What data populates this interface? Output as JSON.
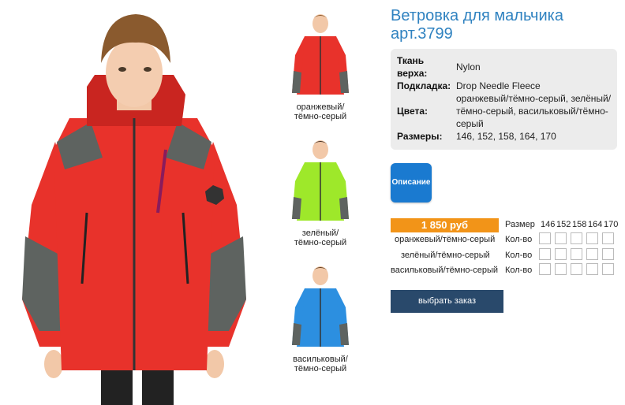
{
  "product": {
    "title": "Ветровка для мальчика арт.3799",
    "specs": [
      {
        "label": "Ткань верха:",
        "value": "Nylon"
      },
      {
        "label": "Подкладка:",
        "value": "Drop Needle Fleece"
      },
      {
        "label": "Цвета:",
        "value": "оранжевый/тёмно-серый, зелёный/тёмно-серый, васильковый/тёмно-серый"
      },
      {
        "label": "Размеры:",
        "value": "146, 152, 158, 164, 170"
      }
    ],
    "description_button": "Описание",
    "price": "1 850 руб",
    "order_button": "выбрать заказ"
  },
  "thumbnails": [
    {
      "caption_line1": "оранжевый/",
      "caption_line2": "тёмно-серый",
      "color": "#e8322b"
    },
    {
      "caption_line1": "зелёный/",
      "caption_line2": "тёмно-серый",
      "color": "#9ee82a"
    },
    {
      "caption_line1": "васильковый/",
      "caption_line2": "тёмно-серый",
      "color": "#2c8fe0"
    }
  ],
  "order_table": {
    "size_label": "Размер",
    "sizes": [
      "146",
      "152",
      "158",
      "164",
      "170"
    ],
    "qty_label": "Кол-во",
    "rows": [
      {
        "color": "оранжевый/тёмно-серый"
      },
      {
        "color": "зелёный/тёмно-серый"
      },
      {
        "color": "васильковый/тёмно-серый"
      }
    ]
  },
  "colors": {
    "title": "#2f82c0",
    "price_bg": "#f29418",
    "description_bg": "#1a7ad0",
    "order_bg": "#29496b",
    "jacket_red": "#e8322b",
    "jacket_grey": "#5e6360"
  }
}
